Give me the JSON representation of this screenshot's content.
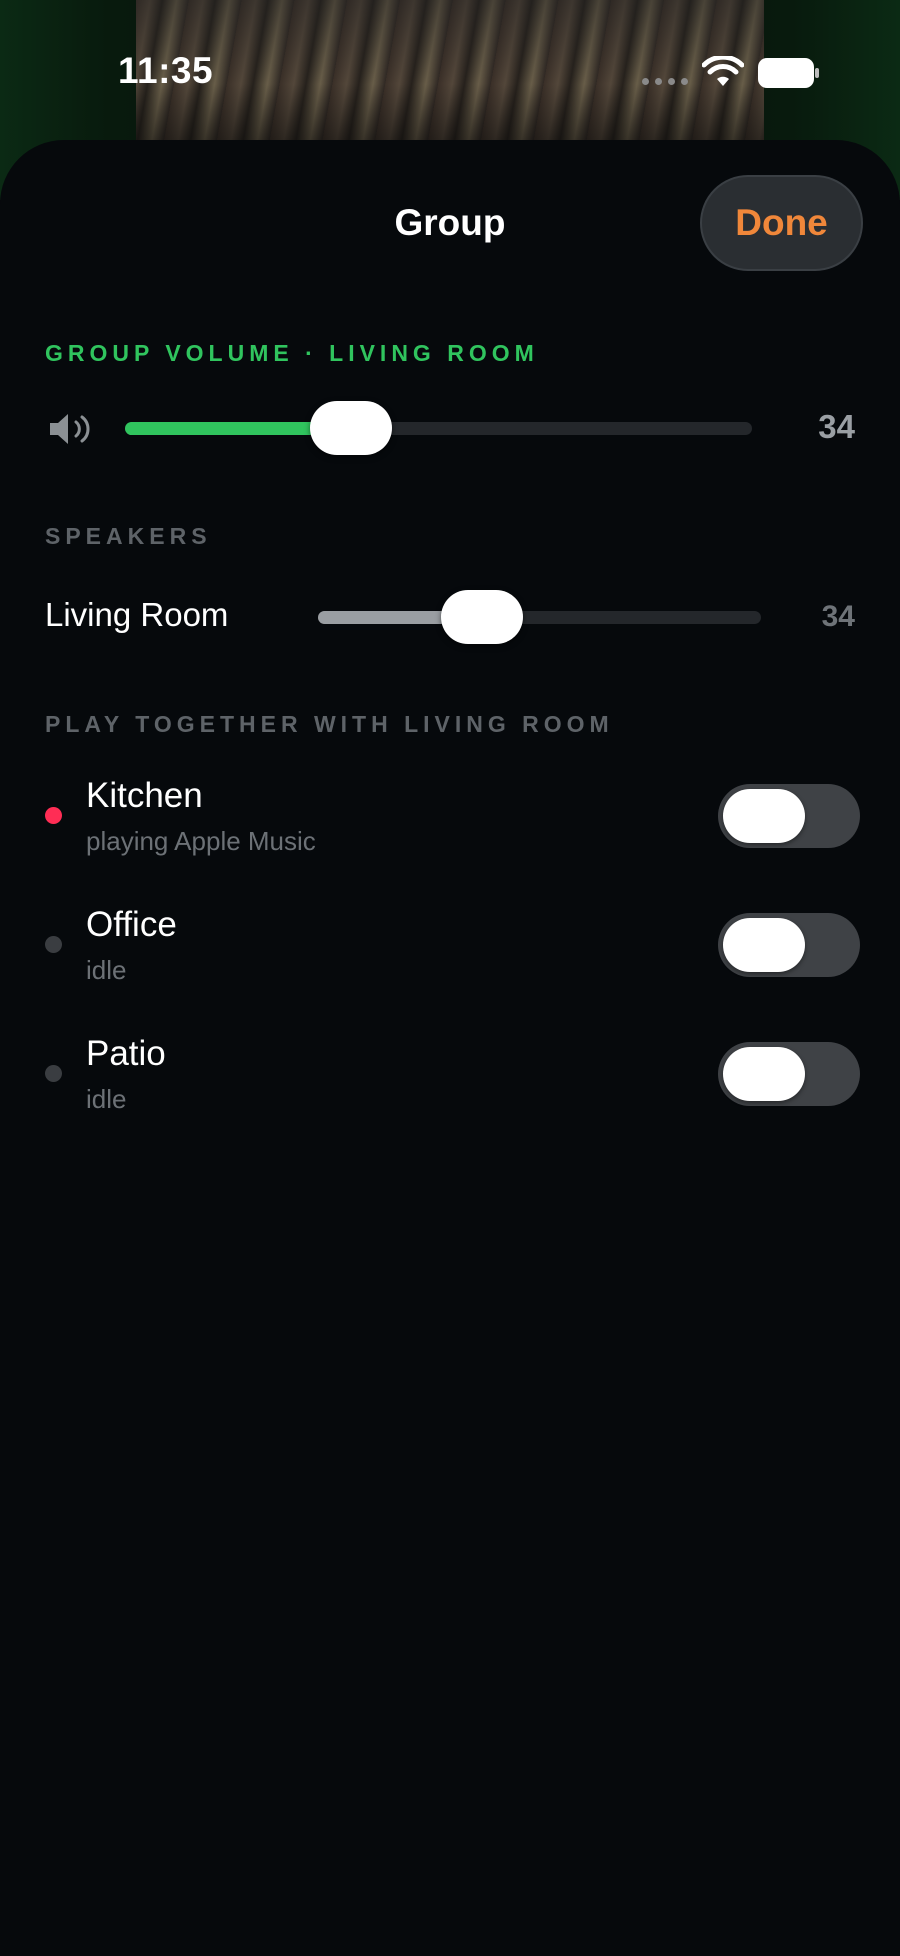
{
  "status_bar": {
    "time": "11:35",
    "icons": [
      "cellular-dots-icon",
      "wifi-icon",
      "battery-icon"
    ]
  },
  "sheet": {
    "title": "Group",
    "done_label": "Done"
  },
  "group_volume": {
    "label": "GROUP VOLUME · LIVING ROOM",
    "value": "34",
    "level_fraction": 0.34,
    "icon": "speaker-volume-icon"
  },
  "speakers": {
    "label": "SPEAKERS",
    "items": [
      {
        "name": "Living Room",
        "value": "34",
        "level_fraction": 0.34
      }
    ]
  },
  "play_together": {
    "label": "PLAY TOGETHER WITH LIVING ROOM",
    "devices": [
      {
        "name": "Kitchen",
        "status": "playing Apple Music",
        "dot_color": "#ff2d55",
        "enabled": false
      },
      {
        "name": "Office",
        "status": "idle",
        "dot_color": "#3a3d41",
        "enabled": false
      },
      {
        "name": "Patio",
        "status": "idle",
        "dot_color": "#3a3d41",
        "enabled": false
      }
    ]
  },
  "colors": {
    "accent_green": "#30c45e",
    "done_orange": "#f0873a",
    "background": "#06090c"
  }
}
